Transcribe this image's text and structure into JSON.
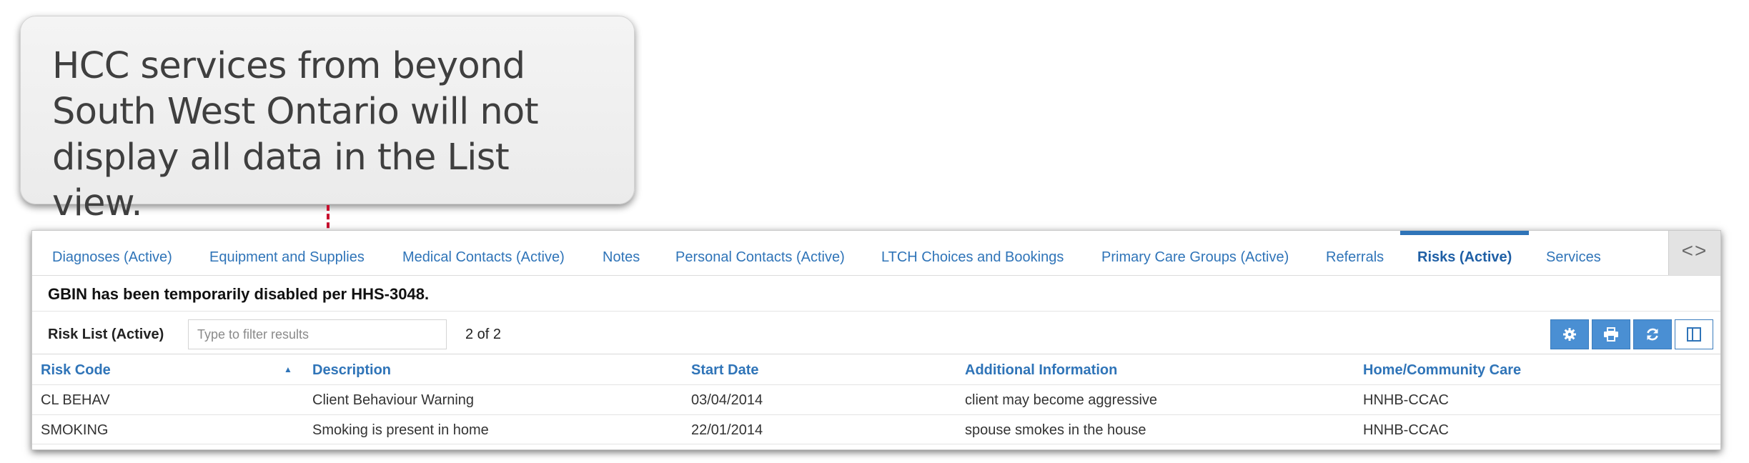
{
  "callout": {
    "text": "HCC services from beyond South West Ontario will not display all data in the List view."
  },
  "tabs": [
    {
      "label": "Diagnoses (Active)"
    },
    {
      "label": "Equipment and Supplies"
    },
    {
      "label": "Medical Contacts (Active)"
    },
    {
      "label": "Notes"
    },
    {
      "label": "Personal Contacts (Active)"
    },
    {
      "label": "LTCH Choices and Bookings"
    },
    {
      "label": "Primary Care Groups (Active)"
    },
    {
      "label": "Referrals"
    },
    {
      "label": "Risks (Active)",
      "active": true
    },
    {
      "label": "Services"
    }
  ],
  "tab_scroll_icon": "code-arrows-icon",
  "notice": "GBIN has been temporarily disabled per HHS-3048.",
  "list": {
    "label": "Risk List (Active)",
    "filter_placeholder": "Type to filter results",
    "count": "2 of 2"
  },
  "toolbar": [
    {
      "icon": "gear-icon"
    },
    {
      "icon": "print-icon"
    },
    {
      "icon": "refresh-icon"
    },
    {
      "icon": "columns-icon"
    }
  ],
  "table": {
    "headers": [
      "Risk Code",
      "Description",
      "Start Date",
      "Additional Information",
      "Home/Community Care"
    ],
    "sort_indicator": "▲",
    "rows": [
      [
        "CL BEHAV",
        "Client Behaviour Warning",
        "03/04/2014",
        "client may become aggressive",
        "HNHB-CCAC"
      ],
      [
        "SMOKING",
        "Smoking is present in home",
        "22/01/2014",
        "spouse smokes in the house",
        "HNHB-CCAC"
      ]
    ]
  },
  "colors": {
    "accent": "#2f74b8",
    "button": "#4a8fd3",
    "pointer": "#c8102e"
  }
}
